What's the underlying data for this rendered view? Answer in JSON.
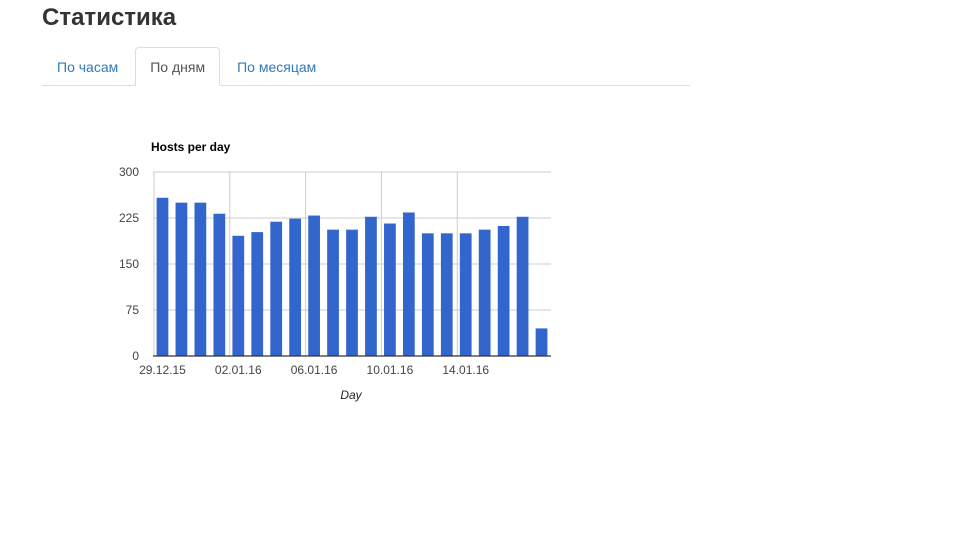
{
  "page": {
    "title": "Статистика"
  },
  "tabs": [
    {
      "label": "По часам",
      "active": false
    },
    {
      "label": "По дням",
      "active": true
    },
    {
      "label": "По месяцам",
      "active": false
    }
  ],
  "colors": {
    "bar": "#3366cc",
    "grid": "#cccccc",
    "axis": "#333333",
    "tab_link": "#337ab7"
  },
  "chart_data": {
    "type": "bar",
    "title": "Hosts per day",
    "xlabel": "Day",
    "ylabel": "",
    "ylim": [
      0,
      300
    ],
    "yticks": [
      0,
      75,
      150,
      225,
      300
    ],
    "grid": true,
    "legend": "none",
    "categories": [
      "29.12.15",
      "30.12.15",
      "31.12.15",
      "01.01.16",
      "02.01.16",
      "03.01.16",
      "04.01.16",
      "05.01.16",
      "06.01.16",
      "07.01.16",
      "08.01.16",
      "09.01.16",
      "10.01.16",
      "11.01.16",
      "12.01.16",
      "13.01.16",
      "14.01.16",
      "15.01.16",
      "16.01.16",
      "17.01.16",
      "18.01.16"
    ],
    "xtick_labels": [
      "29.12.15",
      "02.01.16",
      "06.01.16",
      "10.01.16",
      "14.01.16"
    ],
    "values": [
      258,
      250,
      250,
      232,
      196,
      202,
      219,
      224,
      229,
      206,
      206,
      227,
      216,
      234,
      200,
      200,
      200,
      206,
      212,
      227,
      45
    ]
  }
}
